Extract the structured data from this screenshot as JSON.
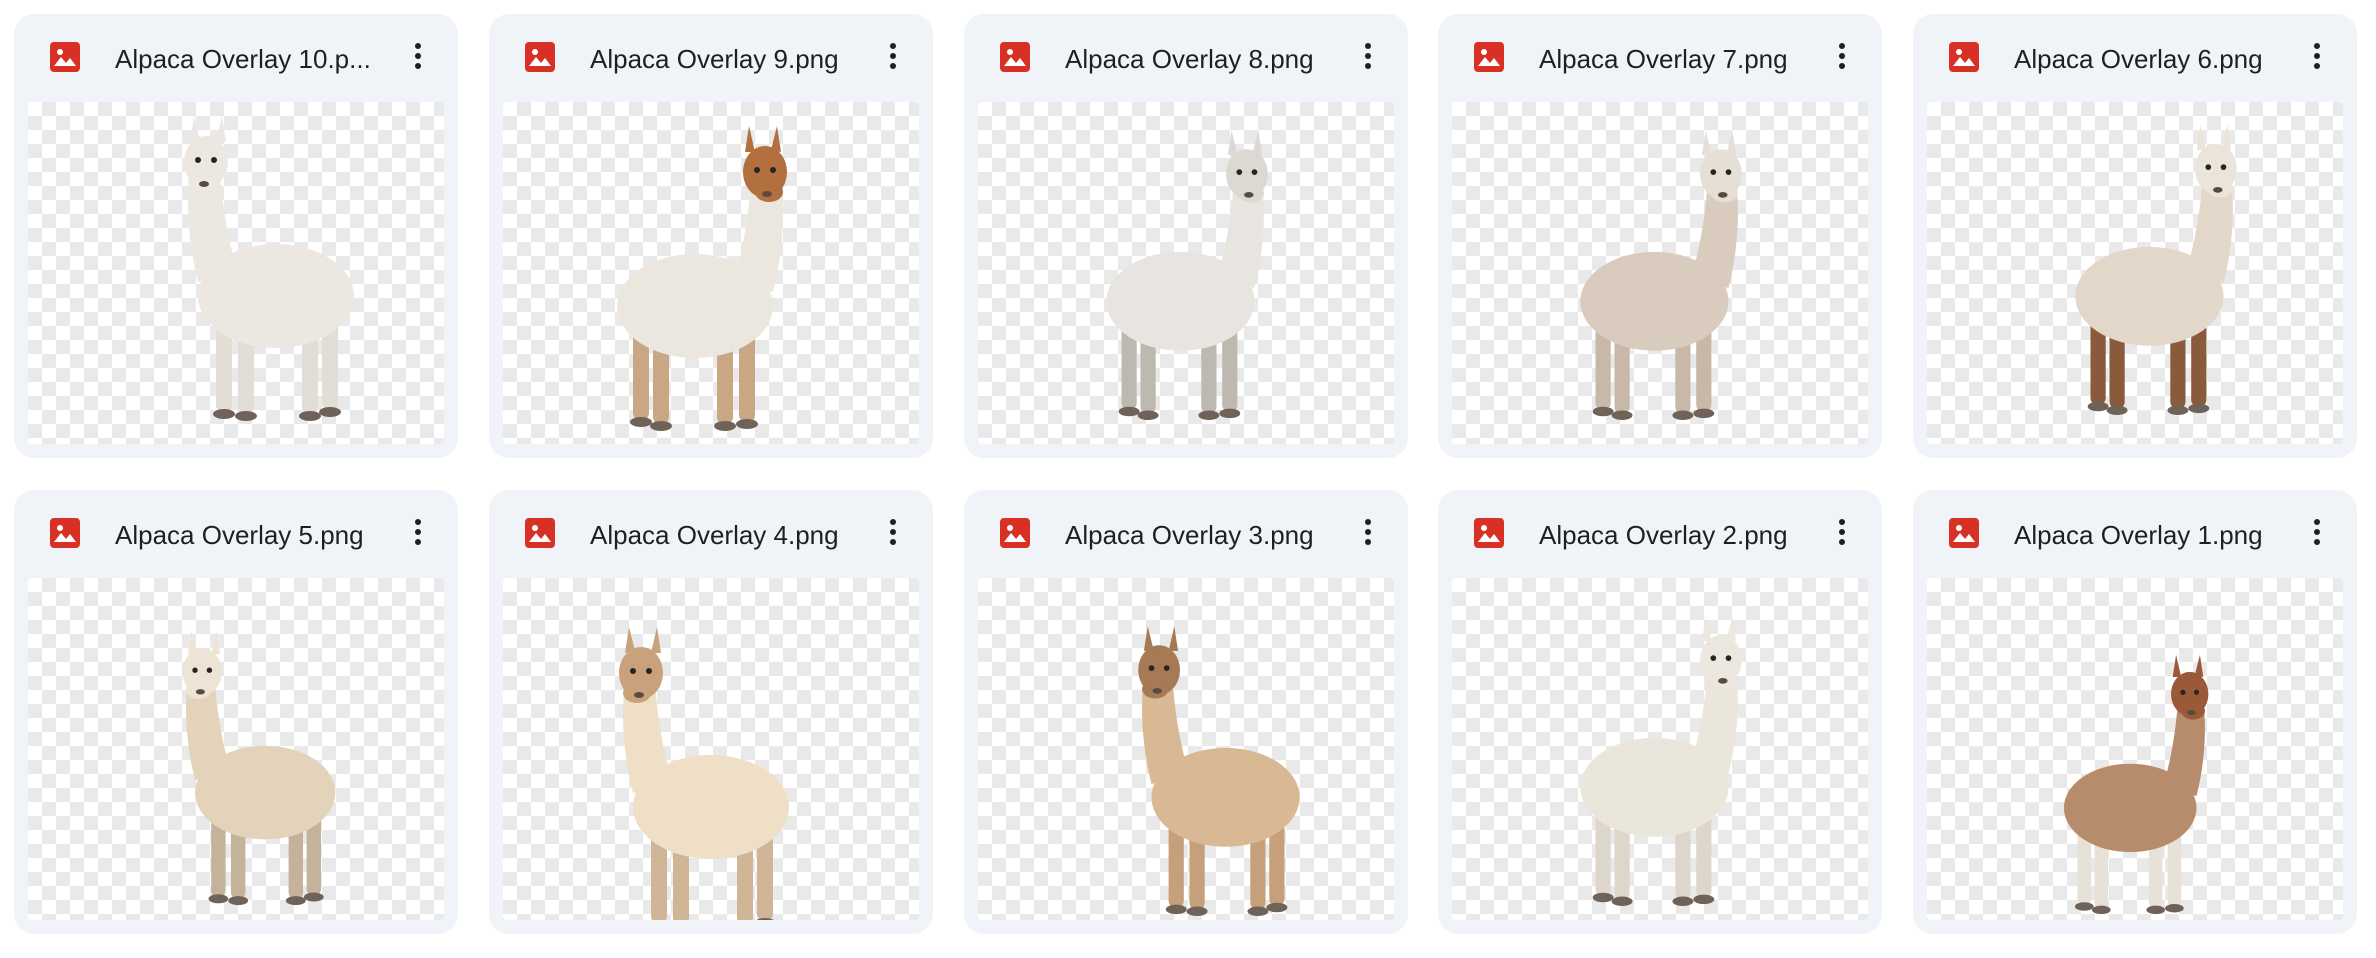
{
  "files": [
    {
      "name": "Alpaca Overlay 10.png",
      "display": "Alpaca Overlay 10.p...",
      "fur": "#ece8e1",
      "head": "#ece8e1",
      "legs": "#e2ddd5"
    },
    {
      "name": "Alpaca Overlay 9.png",
      "display": "Alpaca Overlay 9.png",
      "fur": "#ece7de",
      "head": "#b2703e",
      "legs": "#c9a784"
    },
    {
      "name": "Alpaca Overlay 8.png",
      "display": "Alpaca Overlay 8.png",
      "fur": "#e8e5e0",
      "head": "#dcd8d2",
      "legs": "#bdb8b0"
    },
    {
      "name": "Alpaca Overlay 7.png",
      "display": "Alpaca Overlay 7.png",
      "fur": "#d9cbbd",
      "head": "#e6dfd6",
      "legs": "#c8b8a8"
    },
    {
      "name": "Alpaca Overlay 6.png",
      "display": "Alpaca Overlay 6.png",
      "fur": "#e3d7c9",
      "head": "#ebe4da",
      "legs": "#8a5a3c"
    },
    {
      "name": "Alpaca Overlay 5.png",
      "display": "Alpaca Overlay 5.png",
      "fur": "#e4d3bb",
      "head": "#eee4d6",
      "legs": "#c5b29a"
    },
    {
      "name": "Alpaca Overlay 4.png",
      "display": "Alpaca Overlay 4.png",
      "fur": "#efdfc6",
      "head": "#c9a27c",
      "legs": "#cfb595"
    },
    {
      "name": "Alpaca Overlay 3.png",
      "display": "Alpaca Overlay 3.png",
      "fur": "#d9b894",
      "head": "#a57a55",
      "legs": "#c6a07a"
    },
    {
      "name": "Alpaca Overlay 2.png",
      "display": "Alpaca Overlay 2.png",
      "fur": "#ebe6dc",
      "head": "#ece7df",
      "legs": "#ddd6cb"
    },
    {
      "name": "Alpaca Overlay 1.png",
      "display": "Alpaca Overlay 1.png",
      "fur": "#b78c6c",
      "head": "#9a5a3a",
      "legs": "#e7e1d8"
    }
  ],
  "file_type_icon": "image-file-icon",
  "more_icon": "more-vert-icon",
  "colors": {
    "card_bg": "#f0f4f9",
    "icon_red": "#d93025",
    "text": "#1f1f1f",
    "checker": "#e9e9e9"
  }
}
